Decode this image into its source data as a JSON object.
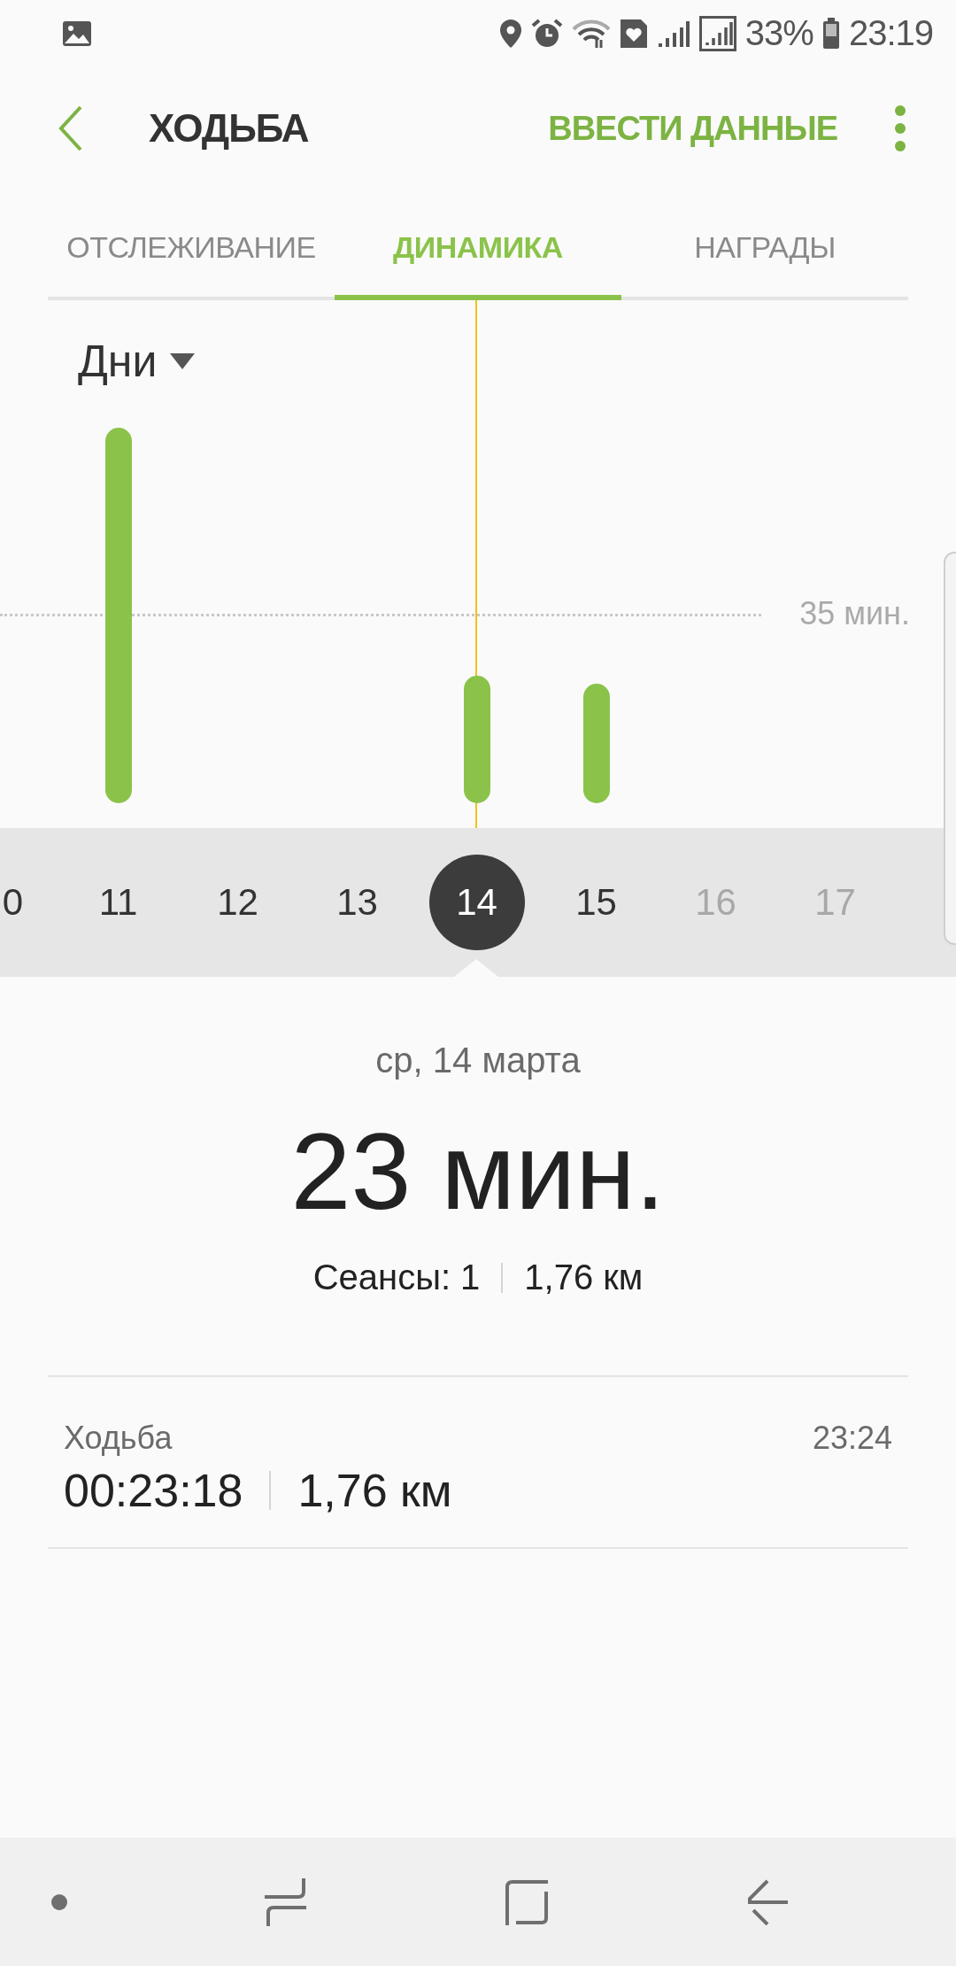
{
  "status_bar": {
    "battery_percent": "33%",
    "time": "23:19"
  },
  "header": {
    "title": "ХОДЬБА",
    "action": "ВВЕСТИ ДАННЫЕ"
  },
  "tabs": [
    {
      "label": "ОТСЛЕЖИВАНИЕ",
      "selected": false
    },
    {
      "label": "ДИНАМИКА",
      "selected": true
    },
    {
      "label": "НАГРАДЫ",
      "selected": false
    }
  ],
  "period": {
    "label": "Дни"
  },
  "chart": {
    "reference_label": "35 мин."
  },
  "days": [
    {
      "label": "0",
      "selected": false,
      "disabled": false
    },
    {
      "label": "11",
      "selected": false,
      "disabled": false
    },
    {
      "label": "12",
      "selected": false,
      "disabled": false
    },
    {
      "label": "13",
      "selected": false,
      "disabled": false
    },
    {
      "label": "14",
      "selected": true,
      "disabled": false
    },
    {
      "label": "15",
      "selected": false,
      "disabled": false
    },
    {
      "label": "16",
      "selected": false,
      "disabled": true
    },
    {
      "label": "17",
      "selected": false,
      "disabled": true
    }
  ],
  "summary": {
    "date": "ср, 14 марта",
    "total": "23 мин.",
    "sessions": "Сеансы: 1",
    "distance": "1,76 км"
  },
  "sessions": [
    {
      "name": "Ходьба",
      "time": "23:24",
      "duration": "00:23:18",
      "distance": "1,76 км"
    }
  ]
}
